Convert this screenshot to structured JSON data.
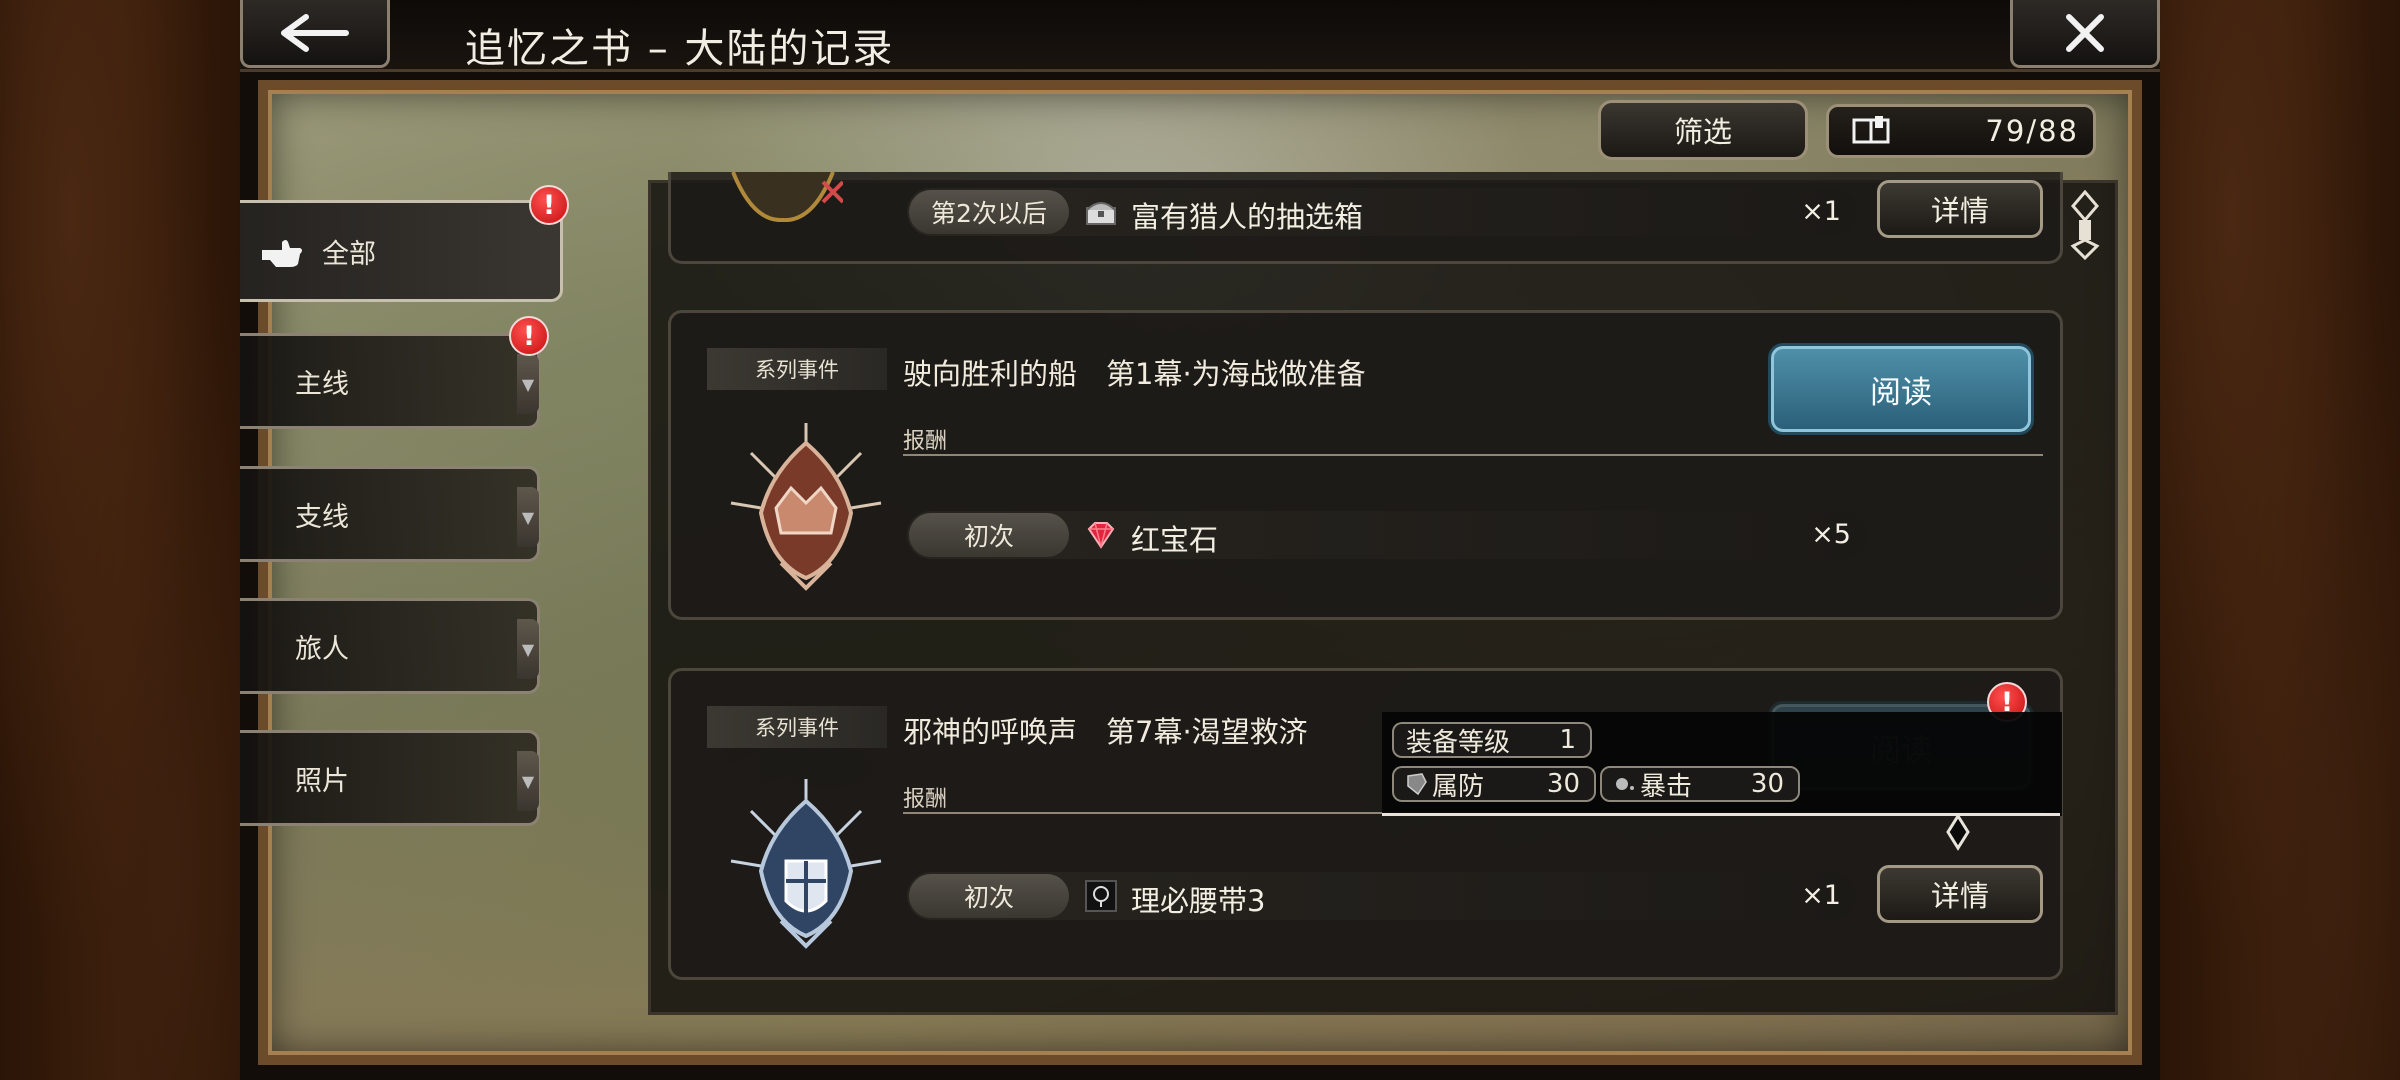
{
  "header": {
    "title": "追忆之书 – 大陆的记录",
    "back_icon": "arrow-left-icon",
    "close_icon": "close-icon"
  },
  "toolbar": {
    "filter_label": "筛选",
    "counter_icon": "book-icon",
    "counter_text": "79/88"
  },
  "sidebar": {
    "items": [
      {
        "label": "全部",
        "active": true,
        "alert": "!"
      },
      {
        "label": "主线",
        "alert": "!"
      },
      {
        "label": "支线"
      },
      {
        "label": "旅人"
      },
      {
        "label": "照片"
      }
    ]
  },
  "list": {
    "partial_row": {
      "condition": "第2次以后",
      "item_name": "富有猎人的抽选箱",
      "qty": "×1",
      "button": "详情"
    },
    "cards": [
      {
        "tag": "系列事件",
        "title": "驶向胜利的船　第1幕·为海战做准备",
        "read_label": "阅读",
        "reward_label": "报酬",
        "reward": {
          "condition": "初次",
          "item_name": "红宝石",
          "qty": "×5"
        }
      },
      {
        "tag": "系列事件",
        "title": "邪神的呼唤声　第7幕·渴望救济",
        "read_label": "阅读",
        "alert": "!",
        "reward_label": "报酬",
        "reward": {
          "condition": "初次",
          "item_name": "理必腰带3",
          "qty": "×1",
          "button": "详情"
        }
      }
    ]
  },
  "tooltip": {
    "level_label": "装备等级",
    "level_value": "1",
    "stat1_label": "属防",
    "stat1_value": "30",
    "stat2_label": "暴击",
    "stat2_value": "30"
  },
  "colors": {
    "accent_read": "#3f7f99",
    "alert_red": "#d81818",
    "frame_brown": "#6b4b2a"
  }
}
